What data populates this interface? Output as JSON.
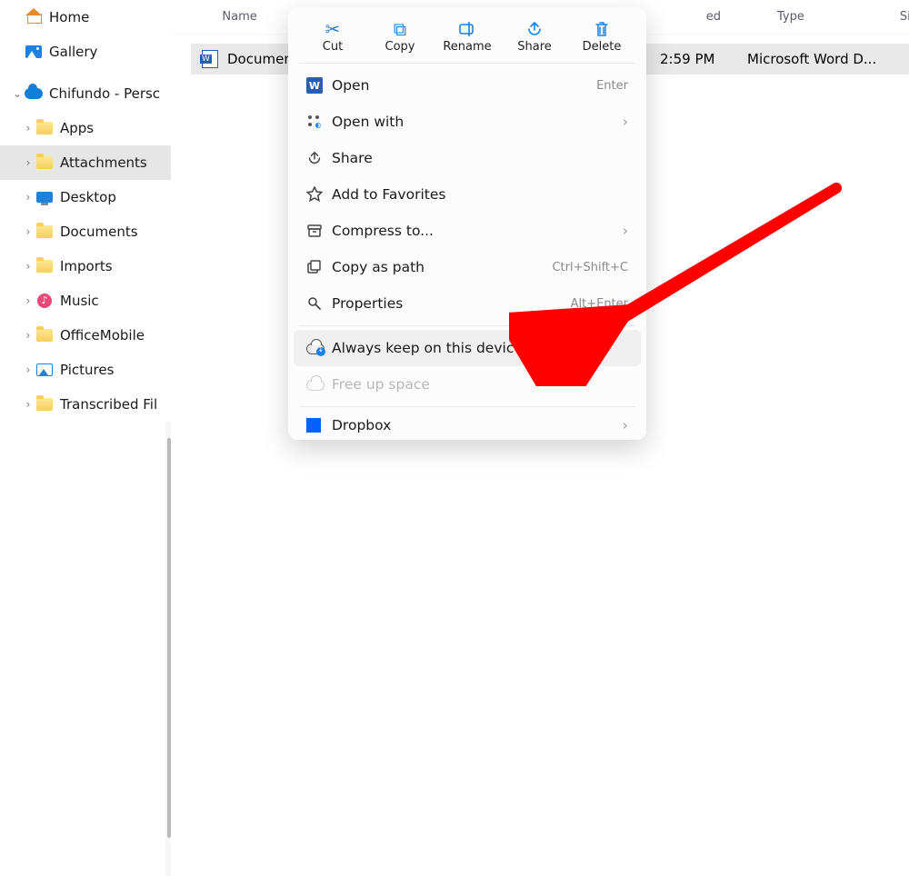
{
  "headers": {
    "name": "Name",
    "ed_tail": "ed",
    "type": "Type",
    "size": "Size"
  },
  "sidebar": {
    "items": [
      {
        "label": "Home"
      },
      {
        "label": "Gallery"
      },
      {
        "label": "Chifundo - Persc"
      },
      {
        "label": "Apps"
      },
      {
        "label": "Attachments"
      },
      {
        "label": "Desktop"
      },
      {
        "label": "Documents"
      },
      {
        "label": "Imports"
      },
      {
        "label": "Music"
      },
      {
        "label": "OfficeMobile"
      },
      {
        "label": "Pictures"
      },
      {
        "label": "Transcribed Fil"
      }
    ]
  },
  "file": {
    "name_visible": "Documen",
    "date_visible": "2:59 PM",
    "type": "Microsoft Word D..."
  },
  "context_menu": {
    "top": [
      {
        "label": "Cut"
      },
      {
        "label": "Copy"
      },
      {
        "label": "Rename"
      },
      {
        "label": "Share"
      },
      {
        "label": "Delete"
      }
    ],
    "items": [
      {
        "label": "Open",
        "shortcut": "Enter"
      },
      {
        "label": "Open with",
        "submenu": true
      },
      {
        "label": "Share"
      },
      {
        "label": "Add to Favorites"
      },
      {
        "label": "Compress to...",
        "submenu": true
      },
      {
        "label": "Copy as path",
        "shortcut": "Ctrl+Shift+C"
      },
      {
        "label": "Properties",
        "shortcut": "Alt+Enter"
      },
      {
        "label": "Always keep on this device"
      },
      {
        "label": "Free up space",
        "disabled": true
      },
      {
        "label": "Dropbox",
        "submenu": true
      }
    ]
  }
}
